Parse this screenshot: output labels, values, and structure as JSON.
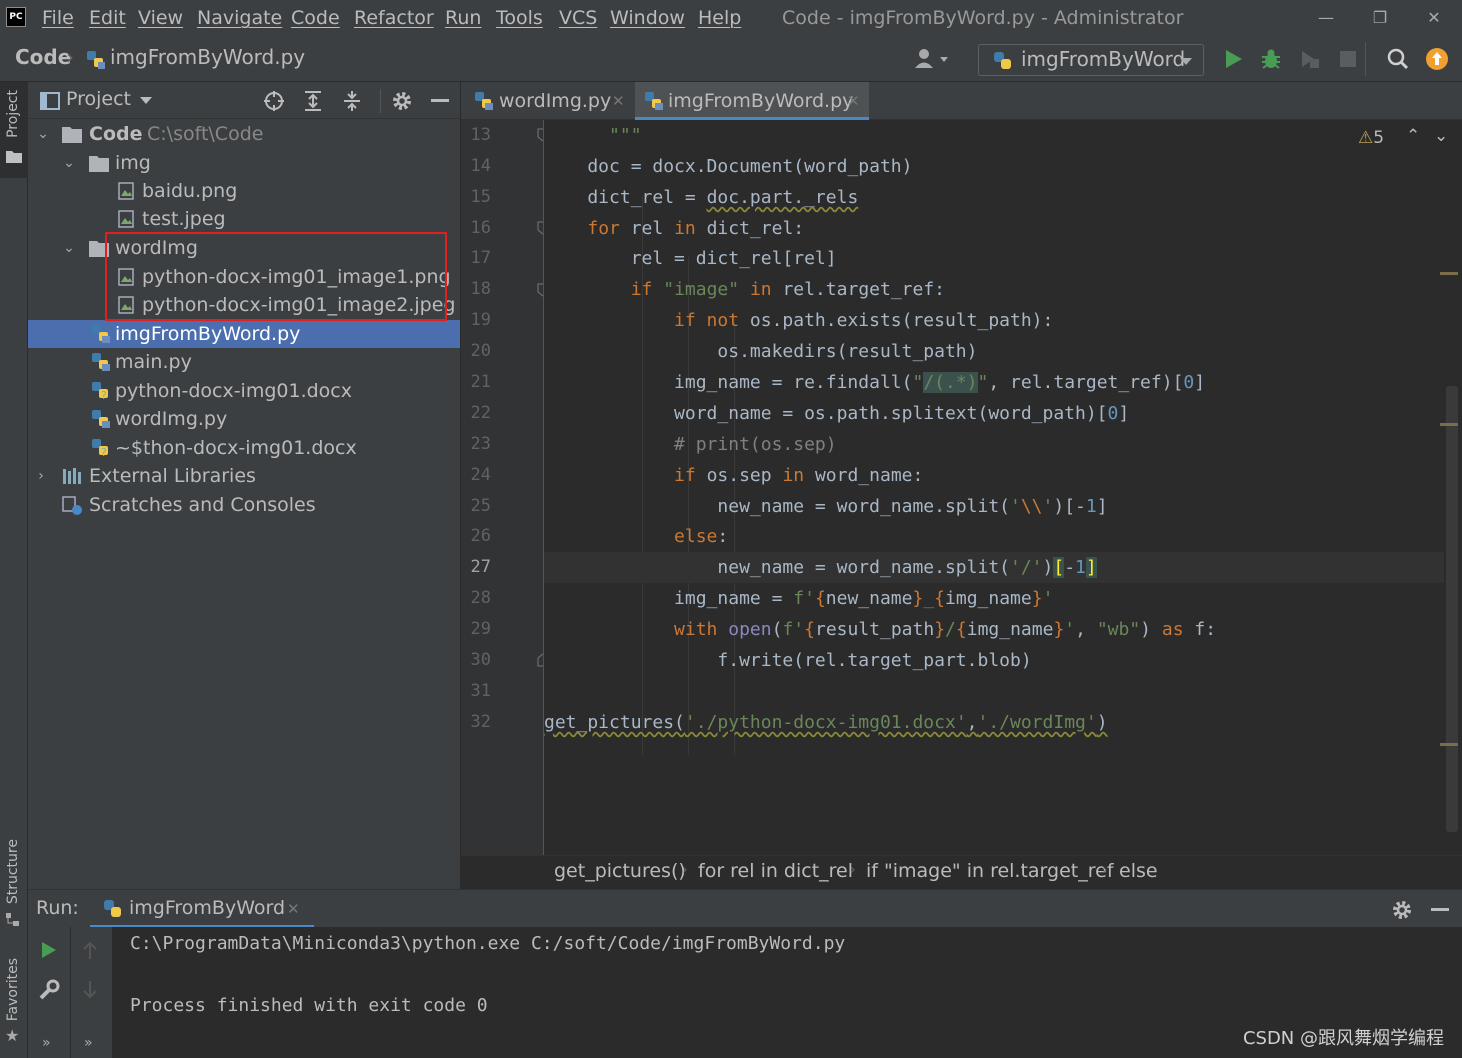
{
  "app": {
    "logo": "PC",
    "window_title": "Code - imgFromByWord.py - Administrator"
  },
  "menu": [
    "File",
    "Edit",
    "View",
    "Navigate",
    "Code",
    "Refactor",
    "Run",
    "Tools",
    "VCS",
    "Window",
    "Help"
  ],
  "navbar": {
    "project": "Code",
    "file": "imgFromByWord.py",
    "run_config": "imgFromByWord"
  },
  "left_strip": {
    "project_tab": "Project",
    "structure_tab": "Structure",
    "favorites_tab": "Favorites"
  },
  "project_panel": {
    "title": "Project",
    "tree": [
      {
        "label": "Code",
        "path": "C:\\soft\\Code",
        "type": "folder",
        "expanded": true
      },
      {
        "label": "img",
        "type": "folder",
        "expanded": true
      },
      {
        "label": "baidu.png",
        "type": "image"
      },
      {
        "label": "test.jpeg",
        "type": "image"
      },
      {
        "label": "wordImg",
        "type": "folder",
        "expanded": true
      },
      {
        "label": "python-docx-img01_image1.png",
        "type": "image"
      },
      {
        "label": "python-docx-img01_image2.jpeg",
        "type": "image"
      },
      {
        "label": "imgFromByWord.py",
        "type": "python",
        "selected": true
      },
      {
        "label": "main.py",
        "type": "python"
      },
      {
        "label": "python-docx-img01.docx",
        "type": "unknown"
      },
      {
        "label": "wordImg.py",
        "type": "python"
      },
      {
        "label": "~$thon-docx-img01.docx",
        "type": "unknown"
      },
      {
        "label": "External Libraries",
        "type": "library",
        "expanded": false
      },
      {
        "label": "Scratches and Consoles",
        "type": "scratch"
      }
    ]
  },
  "editor": {
    "tabs": [
      {
        "label": "wordImg.py",
        "active": false
      },
      {
        "label": "imgFromByWord.py",
        "active": true
      }
    ],
    "warnings": "5",
    "current_line": 27,
    "line_numbers": [
      "13",
      "14",
      "15",
      "16",
      "17",
      "18",
      "19",
      "20",
      "21",
      "22",
      "23",
      "24",
      "25",
      "26",
      "27",
      "28",
      "29",
      "30",
      "31",
      "32"
    ],
    "breadcrumbs": [
      "get_pictures()",
      "for rel in dict_rel",
      "if \"image\" in rel.target_ref",
      "else"
    ]
  },
  "run_panel": {
    "label": "Run:",
    "tab": "imgFromByWord",
    "output": [
      "C:\\ProgramData\\Miniconda3\\python.exe C:/soft/Code/imgFromByWord.py",
      "",
      "Process finished with exit code 0"
    ]
  },
  "watermark": "CSDN @跟风舞烟学编程",
  "colors": {
    "selection": "#4b6eaf",
    "keyword": "#cc7832",
    "string": "#6a8759",
    "number": "#6897bb",
    "highlight_box": "#e02020",
    "run_green": "#499c54"
  }
}
